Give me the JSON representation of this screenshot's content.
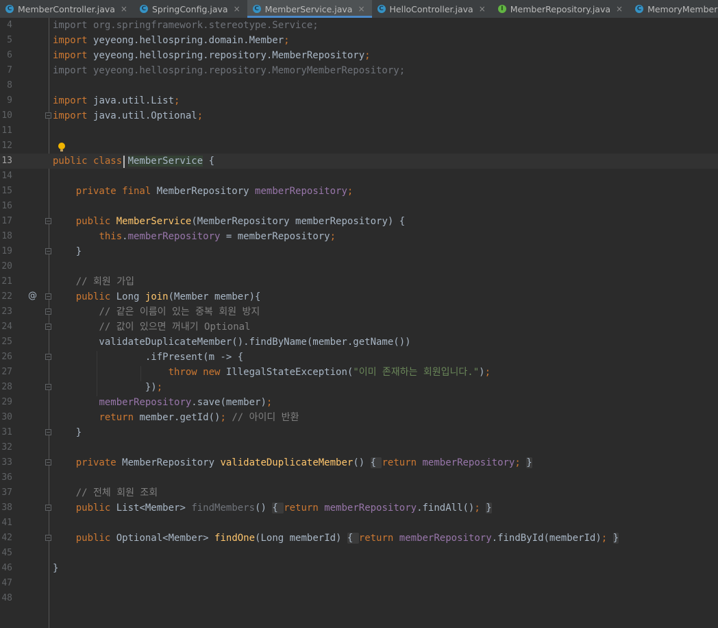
{
  "tabs": [
    {
      "label": "MemberController.java",
      "icon": "class-icon",
      "active": false
    },
    {
      "label": "SpringConfig.java",
      "icon": "class-icon",
      "active": false
    },
    {
      "label": "MemberService.java",
      "icon": "class-icon",
      "active": true
    },
    {
      "label": "HelloController.java",
      "icon": "class-icon",
      "active": false
    },
    {
      "label": "MemberRepository.java",
      "icon": "interface-icon",
      "active": false
    },
    {
      "label": "MemoryMemberRepository.java",
      "icon": "class-icon",
      "active": false
    }
  ],
  "tab_close_glyph": "×",
  "icon_glyphs": {
    "class": "C",
    "interface": "I",
    "override": "@"
  },
  "lines": [
    {
      "n": "4",
      "t": [
        [
          "unused",
          "import org.springframework.stereotype.Service;"
        ]
      ]
    },
    {
      "n": "5",
      "t": [
        [
          "kw",
          "import "
        ],
        [
          "",
          "yeyeong.hellospring.domain.Member"
        ],
        [
          "kw",
          ";"
        ]
      ]
    },
    {
      "n": "6",
      "t": [
        [
          "kw",
          "import "
        ],
        [
          "",
          "yeyeong.hellospring.repository.MemberRepository"
        ],
        [
          "kw",
          ";"
        ]
      ]
    },
    {
      "n": "7",
      "t": [
        [
          "unused",
          "import yeyeong.hellospring.repository.MemoryMemberRepository;"
        ]
      ]
    },
    {
      "n": "8",
      "t": []
    },
    {
      "n": "9",
      "t": [
        [
          "kw",
          "import "
        ],
        [
          "",
          "java.util.List"
        ],
        [
          "kw",
          ";"
        ]
      ]
    },
    {
      "n": "10",
      "t": [
        [
          "kw",
          "import "
        ],
        [
          "",
          "java.util.Optional"
        ],
        [
          "kw",
          ";"
        ]
      ],
      "fold": true
    },
    {
      "n": "11",
      "t": []
    },
    {
      "n": "12",
      "t": []
    },
    {
      "n": "13",
      "t": [
        [
          "kw",
          "public class "
        ],
        [
          "caret-hl",
          "MemberService"
        ],
        [
          "",
          " {"
        ]
      ],
      "current": true
    },
    {
      "n": "14",
      "t": []
    },
    {
      "n": "15",
      "t": [
        [
          "",
          "    "
        ],
        [
          "kw",
          "private final "
        ],
        [
          "",
          "MemberRepository "
        ],
        [
          "fld",
          "memberRepository"
        ],
        [
          "kw",
          ";"
        ]
      ]
    },
    {
      "n": "16",
      "t": []
    },
    {
      "n": "17",
      "t": [
        [
          "",
          "    "
        ],
        [
          "kw",
          "public "
        ],
        [
          "fn",
          "MemberService"
        ],
        [
          "",
          "(MemberRepository memberRepository) {"
        ]
      ],
      "fold": true
    },
    {
      "n": "18",
      "t": [
        [
          "",
          "        "
        ],
        [
          "kw",
          "this"
        ],
        [
          "",
          "."
        ],
        [
          "fld",
          "memberRepository"
        ],
        [
          "",
          " = memberRepository"
        ],
        [
          "kw",
          ";"
        ]
      ]
    },
    {
      "n": "19",
      "t": [
        [
          "",
          "    }"
        ]
      ],
      "fold": true
    },
    {
      "n": "20",
      "t": []
    },
    {
      "n": "21",
      "t": [
        [
          "",
          "    "
        ],
        [
          "cmt",
          "// 회원 가입"
        ]
      ]
    },
    {
      "n": "22",
      "t": [
        [
          "",
          "    "
        ],
        [
          "kw",
          "public "
        ],
        [
          "",
          "Long "
        ],
        [
          "fn",
          "join"
        ],
        [
          "",
          "(Member member){"
        ]
      ],
      "fold": true,
      "override": true
    },
    {
      "n": "23",
      "t": [
        [
          "",
          "        "
        ],
        [
          "cmt",
          "// 같은 이름이 있는 중복 회원 방지"
        ]
      ],
      "fold": true
    },
    {
      "n": "24",
      "t": [
        [
          "",
          "        "
        ],
        [
          "cmt",
          "// 값이 있으면 꺼내기 Optional"
        ]
      ],
      "fold": true
    },
    {
      "n": "25",
      "t": [
        [
          "",
          "        validateDuplicateMember().findByName(member.getName())"
        ]
      ]
    },
    {
      "n": "26",
      "t": [
        [
          "",
          "                .ifPresent(m -> {"
        ]
      ],
      "fold": true
    },
    {
      "n": "27",
      "t": [
        [
          "",
          "                    "
        ],
        [
          "kw",
          "throw new "
        ],
        [
          "",
          "IllegalStateException("
        ],
        [
          "str",
          "\"이미 존재하는 회원입니다.\""
        ],
        [
          "",
          ")"
        ],
        [
          "kw",
          ";"
        ]
      ]
    },
    {
      "n": "28",
      "t": [
        [
          "",
          "                })"
        ],
        [
          "kw",
          ";"
        ]
      ],
      "fold": true
    },
    {
      "n": "29",
      "t": [
        [
          "",
          "        "
        ],
        [
          "fld",
          "memberRepository"
        ],
        [
          "",
          ".save(member)"
        ],
        [
          "kw",
          ";"
        ]
      ]
    },
    {
      "n": "30",
      "t": [
        [
          "",
          "        "
        ],
        [
          "kw",
          "return "
        ],
        [
          "",
          "member.getId()"
        ],
        [
          "kw",
          "; "
        ],
        [
          "cmt",
          "// 아이디 반환"
        ]
      ]
    },
    {
      "n": "31",
      "t": [
        [
          "",
          "    }"
        ]
      ],
      "fold": true
    },
    {
      "n": "32",
      "t": []
    },
    {
      "n": "33",
      "t": [
        [
          "",
          "    "
        ],
        [
          "kw",
          "private "
        ],
        [
          "",
          "MemberRepository "
        ],
        [
          "fn",
          "validateDuplicateMember"
        ],
        [
          "",
          "() "
        ],
        [
          "fold-box",
          "{ "
        ],
        [
          "kw",
          "return "
        ],
        [
          "fld",
          "memberRepository"
        ],
        [
          "kw",
          ";"
        ],
        [
          "",
          " "
        ],
        [
          "fold-box",
          "}"
        ]
      ],
      "fold": true
    },
    {
      "n": "36",
      "t": []
    },
    {
      "n": "37",
      "t": [
        [
          "",
          "    "
        ],
        [
          "cmt",
          "// 전체 회원 조회"
        ]
      ]
    },
    {
      "n": "38",
      "t": [
        [
          "",
          "    "
        ],
        [
          "kw",
          "public "
        ],
        [
          "",
          "List<Member> "
        ],
        [
          "unused",
          "findMembers"
        ],
        [
          "",
          "() "
        ],
        [
          "fold-box",
          "{ "
        ],
        [
          "kw",
          "return "
        ],
        [
          "fld",
          "memberRepository"
        ],
        [
          "",
          ".findAll()"
        ],
        [
          "kw",
          ";"
        ],
        [
          "",
          " "
        ],
        [
          "fold-box",
          "}"
        ]
      ],
      "fold": true
    },
    {
      "n": "41",
      "t": []
    },
    {
      "n": "42",
      "t": [
        [
          "",
          "    "
        ],
        [
          "kw",
          "public "
        ],
        [
          "",
          "Optional<Member> "
        ],
        [
          "fn",
          "findOne"
        ],
        [
          "",
          "(Long memberId) "
        ],
        [
          "fold-box",
          "{ "
        ],
        [
          "kw",
          "return "
        ],
        [
          "fld",
          "memberRepository"
        ],
        [
          "",
          ".findById(memberId)"
        ],
        [
          "kw",
          ";"
        ],
        [
          "",
          " "
        ],
        [
          "fold-box",
          "}"
        ]
      ],
      "fold": true
    },
    {
      "n": "45",
      "t": []
    },
    {
      "n": "46",
      "t": [
        [
          "",
          "}"
        ]
      ]
    },
    {
      "n": "47",
      "t": []
    },
    {
      "n": "48",
      "t": []
    }
  ]
}
